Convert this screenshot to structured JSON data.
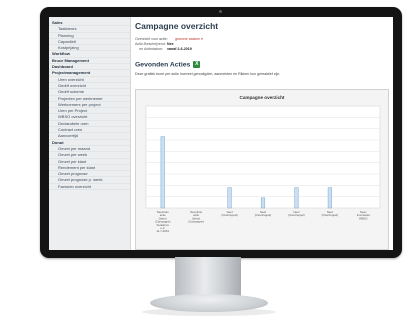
{
  "sidebar": {
    "items": [
      {
        "label": "Sales",
        "level": 0
      },
      {
        "label": "Taakbeurs",
        "level": 1
      },
      {
        "label": "Planning",
        "level": 1
      },
      {
        "label": "Capaciteit",
        "level": 1
      },
      {
        "label": "Kostprijzing",
        "level": 1
      },
      {
        "label": "Workflow",
        "level": 0
      },
      {
        "label": "Bruce Management",
        "level": 0
      },
      {
        "label": "Dashboard",
        "level": 0
      },
      {
        "label": "Projectmanagement",
        "level": 0
      },
      {
        "label": "Uren overzicht",
        "level": 1
      },
      {
        "label": "Gedrif overzicht",
        "level": 1
      },
      {
        "label": "Gedrif scheme",
        "level": 1
      },
      {
        "label": "Projecten per werknemer",
        "level": 1
      },
      {
        "label": "Werknemers per project",
        "level": 1
      },
      {
        "label": "Uren per Project",
        "level": 1
      },
      {
        "label": "WBSO overzicht",
        "level": 1
      },
      {
        "label": "Declarabele uren",
        "level": 1
      },
      {
        "label": "Contract uren",
        "level": 1
      },
      {
        "label": "Aanvoertijd",
        "level": 1
      },
      {
        "label": "Donut",
        "level": 0
      },
      {
        "label": "Omzet per maand",
        "level": 1
      },
      {
        "label": "Omzet per week",
        "level": 1
      },
      {
        "label": "Omzet per klant",
        "level": 1
      },
      {
        "label": "Rendement per klant",
        "level": 1
      },
      {
        "label": "Omzet prognose",
        "level": 1
      },
      {
        "label": "Omzet prognose p. week",
        "level": 1
      },
      {
        "label": "Facturen overzicht",
        "level": 1
      }
    ]
  },
  "page": {
    "title": "Campagne overzicht",
    "info": [
      {
        "label": "Overzicht voor actie:",
        "value": "",
        "link": "gewone zaaken ▾"
      },
      {
        "label": "Actie-Beschrijvend:",
        "value": "Nee",
        "link": ""
      },
      {
        "label": "en Actiedatum:",
        "value": "vanaf 2-6-2019",
        "link": ""
      }
    ],
    "section_title": "Gevonden Acties",
    "export_icon_label": "X",
    "section_desc": "Deze grafiek toont per actie hoeveel genodigden, aanmelden en Rikken hun gereaktief zijn."
  },
  "chart_data": {
    "type": "bar",
    "title": "Campagne overzicht",
    "categories": [
      "Nevofnas actie (Idem) (Campagne) Sedeknos e.d. 11-7-2019",
      "Nevofnas actie (Idem) (Campagne)",
      "Neef (Overtreppel)",
      "Neef (Overtreppel)",
      "Neef (Overtreppel)",
      "Neef (Overtreppel)",
      "Neev Inventariet WBSO"
    ],
    "values": [
      70,
      0,
      20,
      10,
      20,
      20,
      0
    ],
    "ylim": [
      0,
      100
    ],
    "grid": true,
    "bar_color": "#c9dff2",
    "bar_border": "#7ea6cd"
  }
}
